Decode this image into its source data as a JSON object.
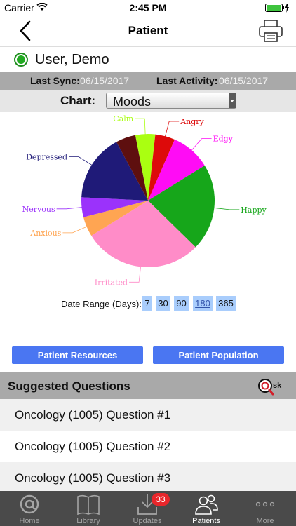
{
  "status_bar": {
    "carrier": "Carrier",
    "time": "2:45 PM"
  },
  "nav": {
    "title": "Patient"
  },
  "patient": {
    "name": "User, Demo",
    "status_color": "#22aa22"
  },
  "sync": {
    "last_sync_label": "Last Sync:",
    "last_sync_value": "06/15/2017",
    "last_activity_label": "Last Activity:",
    "last_activity_value": "06/15/2017"
  },
  "chart_selector": {
    "label": "Chart:",
    "selected": "Moods"
  },
  "chart_data": {
    "type": "pie",
    "slices": [
      {
        "label": "Calm",
        "value": 5,
        "color": "#aaff11"
      },
      {
        "label": "Angry",
        "value": 5,
        "color": "#dd0a0a"
      },
      {
        "label": "Edgy",
        "value": 10,
        "color": "#ff0cf5"
      },
      {
        "label": "Happy",
        "value": 22,
        "color": "#16a61a"
      },
      {
        "label": "Irritated",
        "value": 30,
        "color": "#ff8cc8"
      },
      {
        "label": "Anxious",
        "value": 5,
        "color": "#ffa552"
      },
      {
        "label": "Nervous",
        "value": 5,
        "color": "#9b32fb"
      },
      {
        "label": "Depressed",
        "value": 17,
        "color": "#1f1a78"
      },
      {
        "label": "",
        "value": 5,
        "color": "#5e0f0f"
      }
    ]
  },
  "date_range": {
    "label": "Date Range (Days):",
    "options": [
      "7",
      "30",
      "90",
      "180",
      "365"
    ],
    "selected": "180"
  },
  "buttons": {
    "resources": "Patient Resources",
    "population": "Patient Population"
  },
  "suggested": {
    "title": "Suggested Questions",
    "ask_logo": "@sk",
    "questions": [
      "Oncology (1005) Question #1",
      "Oncology (1005) Question #2",
      "Oncology (1005) Question #3"
    ]
  },
  "tabs": [
    {
      "label": "Home",
      "icon": "at-icon"
    },
    {
      "label": "Library",
      "icon": "book-icon"
    },
    {
      "label": "Updates",
      "icon": "download-icon",
      "badge": "33"
    },
    {
      "label": "Patients",
      "icon": "people-icon",
      "active": true
    },
    {
      "label": "More",
      "icon": "ellipsis-icon"
    }
  ]
}
